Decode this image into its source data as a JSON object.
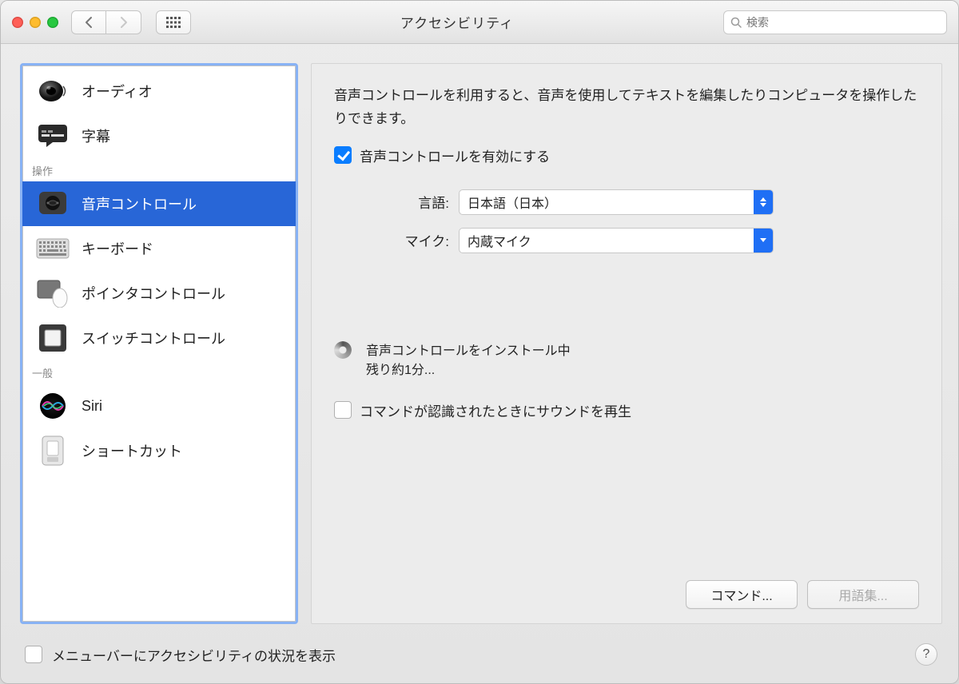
{
  "window": {
    "title": "アクセシビリティ"
  },
  "search": {
    "placeholder": "検索"
  },
  "sidebar": {
    "categories": [
      {
        "items": [
          {
            "id": "audio",
            "label": "オーディオ"
          },
          {
            "id": "captions",
            "label": "字幕"
          }
        ]
      },
      {
        "label": "操作",
        "items": [
          {
            "id": "voice-control",
            "label": "音声コントロール",
            "selected": true
          },
          {
            "id": "keyboard",
            "label": "キーボード"
          },
          {
            "id": "pointer",
            "label": "ポインタコントロール"
          },
          {
            "id": "switch",
            "label": "スイッチコントロール"
          }
        ]
      },
      {
        "label": "一般",
        "items": [
          {
            "id": "siri",
            "label": "Siri"
          },
          {
            "id": "shortcut",
            "label": "ショートカット"
          }
        ]
      }
    ]
  },
  "pane": {
    "description": "音声コントロールを利用すると、音声を使用してテキストを編集したりコンピュータを操作したりできます。",
    "enable": {
      "label": "音声コントロールを有効にする",
      "checked": true
    },
    "language": {
      "label": "言語:",
      "value": "日本語（日本）"
    },
    "microphone": {
      "label": "マイク:",
      "value": "内蔵マイク"
    },
    "installing": {
      "line1": "音声コントロールをインストール中",
      "line2": "残り約1分..."
    },
    "playSound": {
      "label": "コマンドが認識されたときにサウンドを再生",
      "checked": false
    },
    "buttons": {
      "commands": "コマンド...",
      "vocabulary": "用語集..."
    }
  },
  "footer": {
    "menubar": {
      "label": "メニューバーにアクセシビリティの状況を表示",
      "checked": false
    }
  }
}
